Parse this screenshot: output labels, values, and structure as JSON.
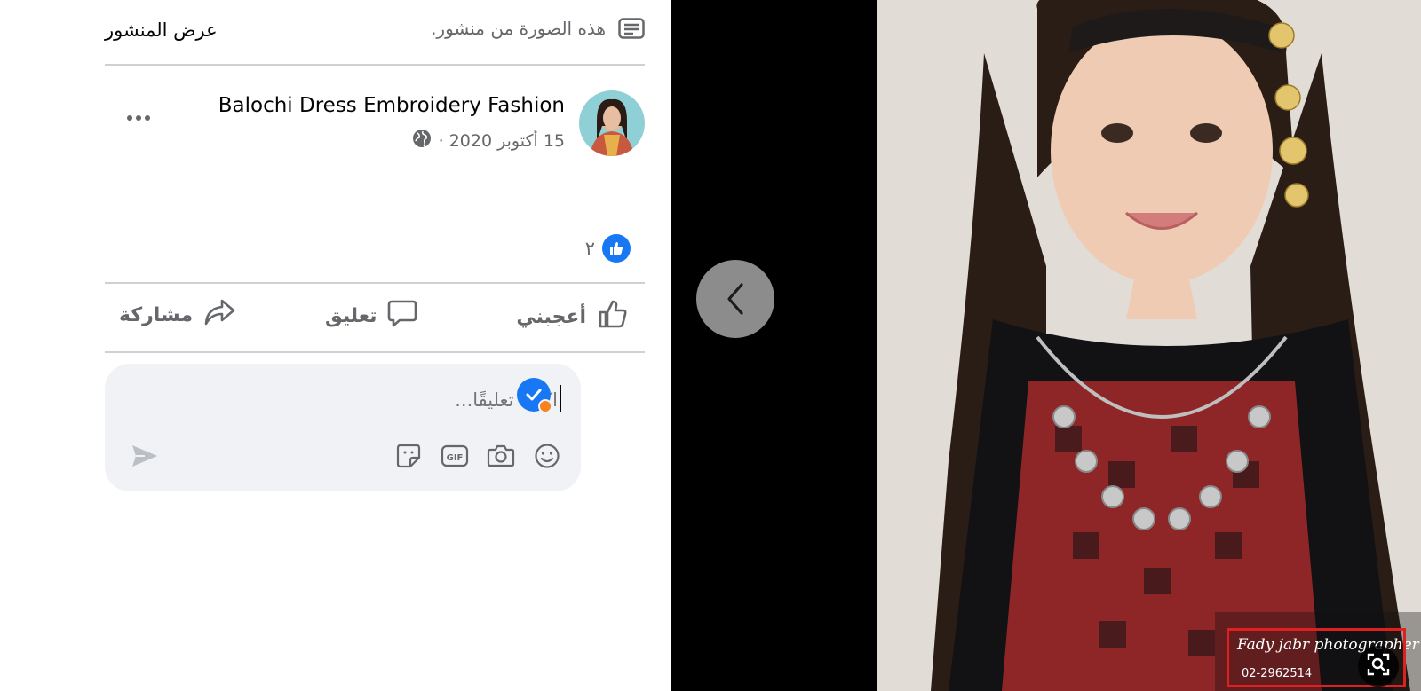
{
  "header": {
    "view_post": "عرض المنشور",
    "note": "هذه الصورة من منشور."
  },
  "post": {
    "author": "Balochi Dress Embroidery Fashion",
    "date": "15 أكتوبر 2020 ·",
    "privacy_icon": "globe-icon",
    "reaction_count": "٢"
  },
  "actions": {
    "like": "أعجبني",
    "comment": "تعليق",
    "share": "مشاركة"
  },
  "composer": {
    "placeholder": "اكتب تعليقًا...",
    "tools": [
      "emoji-icon",
      "camera-icon",
      "gif-icon",
      "sticker-icon"
    ]
  },
  "photo": {
    "watermark": "Fady jabr photographer",
    "watermark_sub": "02-2962514"
  },
  "colors": {
    "accent": "#1877f2",
    "secondary_text": "#65676b",
    "composer_bg": "#f0f2f5",
    "highlight": "#e02020"
  }
}
